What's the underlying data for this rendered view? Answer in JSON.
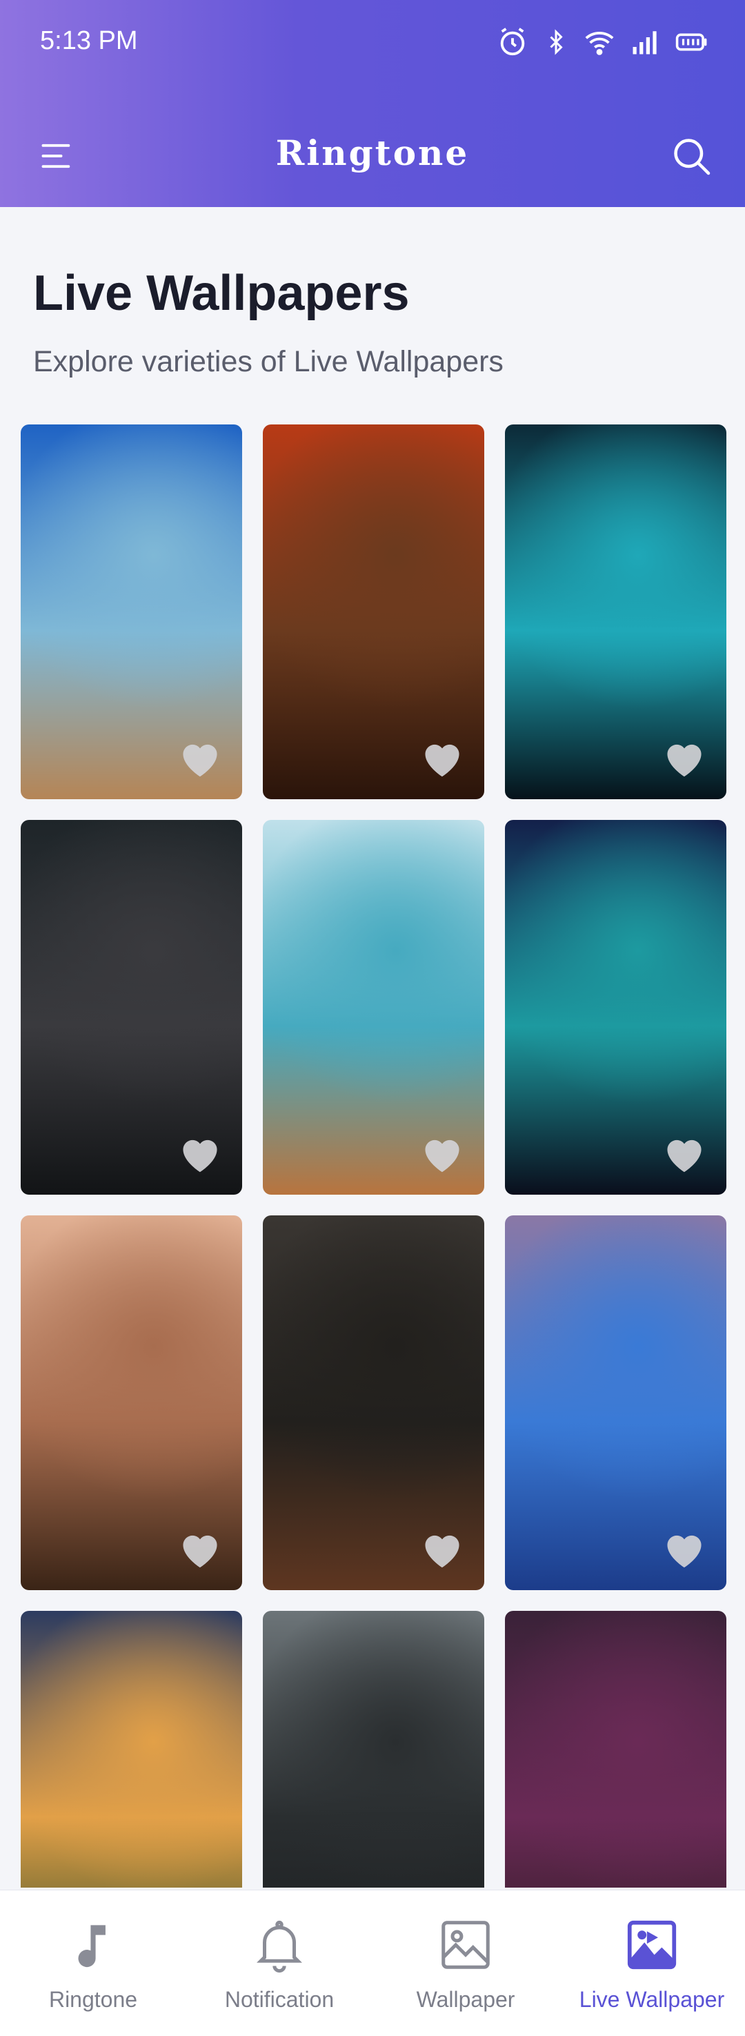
{
  "status_bar": {
    "time": "5:13 PM"
  },
  "header": {
    "title": "Ringtone"
  },
  "page": {
    "title": "Live Wallpapers",
    "subtitle": "Explore varieties of Live Wallpapers"
  },
  "wallpapers": [
    {
      "name": "ocean-waterfall",
      "g1": "#1f63c4",
      "g2": "#7fb8d6",
      "g3": "#b58556"
    },
    {
      "name": "autumn-leaves-rain",
      "g1": "#b83a16",
      "g2": "#6b3a1e",
      "g3": "#2a140a"
    },
    {
      "name": "glowing-canyon",
      "g1": "#0c2a38",
      "g2": "#1fa8b8",
      "g3": "#06121a"
    },
    {
      "name": "butterfly-pebbles",
      "g1": "#1e2529",
      "g2": "#3a3a3e",
      "g3": "#121416"
    },
    {
      "name": "beach-wave",
      "g1": "#bfe0ea",
      "g2": "#46aac0",
      "g3": "#b8743e"
    },
    {
      "name": "night-beach",
      "g1": "#13204a",
      "g2": "#1d9aa0",
      "g3": "#0a0e1c"
    },
    {
      "name": "sunset-lake-boat",
      "g1": "#e2b194",
      "g2": "#a86d4f",
      "g3": "#3a2416"
    },
    {
      "name": "steaming-mug",
      "g1": "#3a3632",
      "g2": "#22201d",
      "g3": "#5e3620"
    },
    {
      "name": "rocky-blue-shore",
      "g1": "#8a78a6",
      "g2": "#3a7ad6",
      "g3": "#1c3c8a"
    },
    {
      "name": "sunset-boat",
      "g1": "#2d3c60",
      "g2": "#e2a048",
      "g3": "#2f4a24"
    },
    {
      "name": "race-car",
      "g1": "#6c7478",
      "g2": "#2a2e30",
      "g3": "#1a1c1e"
    },
    {
      "name": "hooded-warrior",
      "g1": "#3a2238",
      "g2": "#6a2a56",
      "g3": "#2a1a20"
    }
  ],
  "bottom_nav": [
    {
      "label": "Ringtone",
      "icon": "music-note-icon",
      "active": false
    },
    {
      "label": "Notification",
      "icon": "bell-icon",
      "active": false
    },
    {
      "label": "Wallpaper",
      "icon": "image-icon",
      "active": false
    },
    {
      "label": "Live Wallpaper",
      "icon": "live-wallpaper-icon",
      "active": true
    }
  ],
  "colors": {
    "accent": "#5a52d5",
    "header_start": "#8f73e0",
    "header_end": "#5553d8"
  }
}
